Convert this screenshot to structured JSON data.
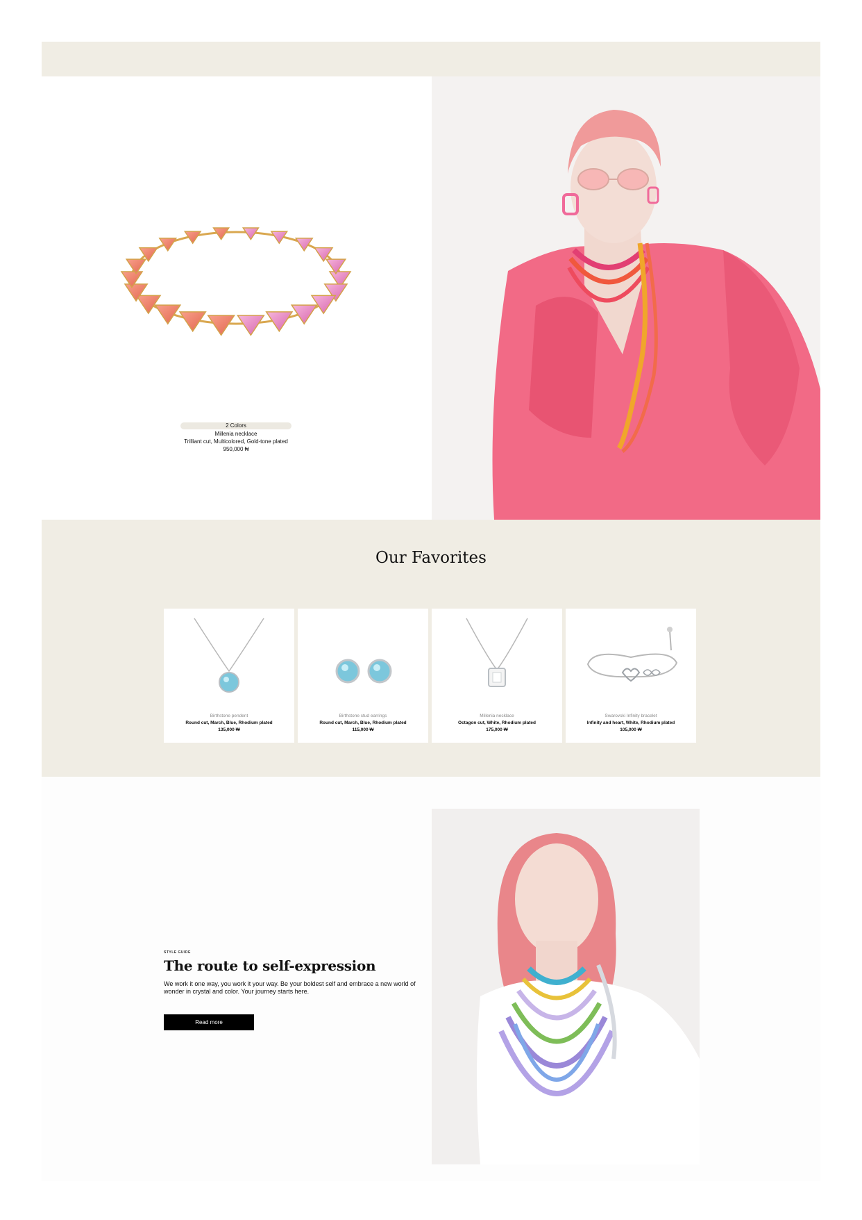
{
  "colors": {
    "band": "#f0ede4",
    "card_bg": "#ffffff",
    "button_bg": "#000000",
    "button_text": "#ffffff",
    "accent_pink": "#f0607e"
  },
  "hero": {
    "product": {
      "colors_badge": "2 Colors",
      "name": "Millenia necklace",
      "description": "Trilliant cut, Multicolored, Gold-tone plated",
      "price": "950,000 ₦"
    }
  },
  "favorites": {
    "title": "Our Favorites",
    "prev_icon": "chevron-left-icon",
    "next_icon": "chevron-right-icon",
    "products": [
      {
        "name": "Birthstone pendent",
        "description": "Round cut, March, Blue, Rhodium plated",
        "price": "135,000 ₩"
      },
      {
        "name": "Birthstone stud earrings",
        "description": "Round cut, March, Blue, Rhodium plated",
        "price": "115,000 ₩"
      },
      {
        "name": "Millenia necklace",
        "description": "Octagon cut, White, Rhodium plated",
        "price": "175,000 ₩"
      },
      {
        "name": "Swarovski Infinity bracelet",
        "description": "Infinity and heart, White, Rhodium plated",
        "price": "105,000 ₩"
      }
    ]
  },
  "story": {
    "eyebrow": "STYLE GUIDE",
    "title": "The route to self-expression",
    "body": "We work it one way, you work it your way. Be your boldest self and embrace a new world of wonder in crystal and color. Your journey starts here.",
    "button_label": "Read more"
  }
}
